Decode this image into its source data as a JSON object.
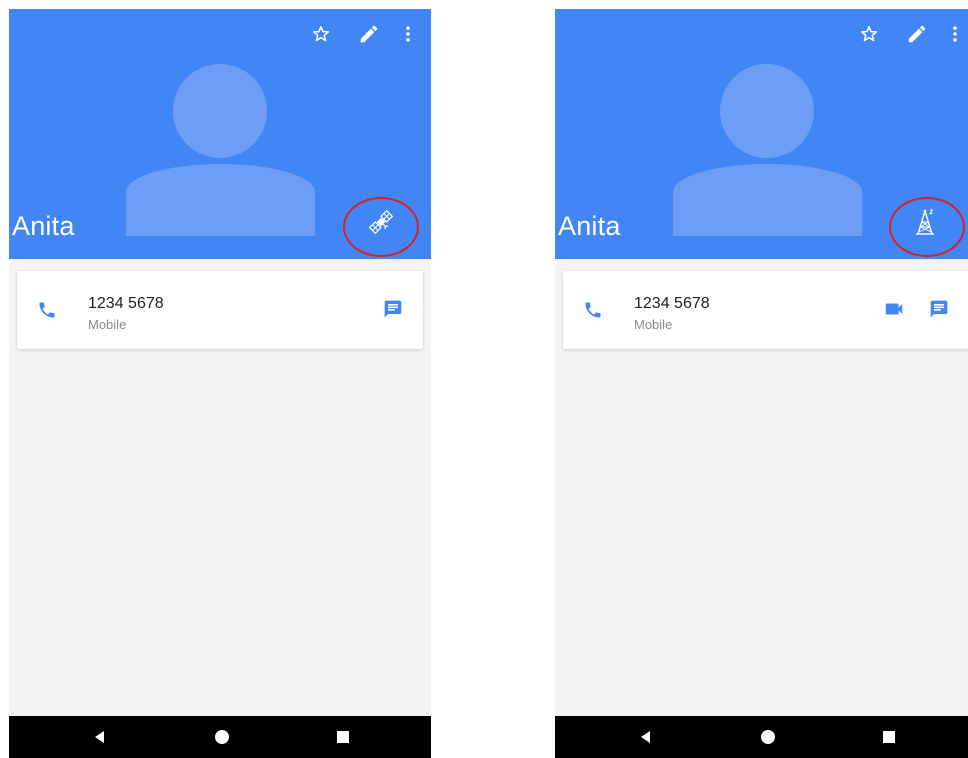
{
  "colors": {
    "accent": "#4285f4",
    "avatar": "#6c9ef6",
    "highlight_ring": "#d2232a",
    "icon_blue": "#4285f4"
  },
  "screens": [
    {
      "contact_name": "Anita",
      "account_icon": "satellite-icon",
      "phone_entry": {
        "number": "1234 5678",
        "type": "Mobile",
        "actions": [
          "message-icon"
        ]
      }
    },
    {
      "contact_name": "Anita",
      "account_icon": "cell-tower-icon",
      "phone_entry": {
        "number": "1234 5678",
        "type": "Mobile",
        "actions": [
          "video-call-icon",
          "message-icon"
        ]
      }
    }
  ]
}
